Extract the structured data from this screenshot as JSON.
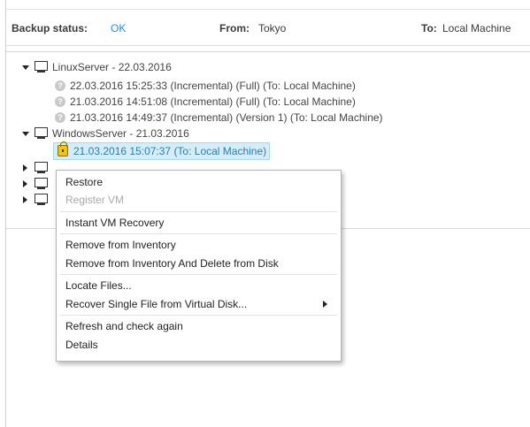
{
  "status": {
    "backup_label": "Backup status:",
    "backup_value": "OK",
    "from_label": "From:",
    "from_value": "Tokyo",
    "to_label": "To:",
    "to_value": "Local Machine"
  },
  "tree": {
    "servers": [
      {
        "label": "LinuxServer - 22.03.2016",
        "expanded": true,
        "backups": [
          "22.03.2016 15:25:33 (Incremental) (Full) (To: Local Machine)",
          "21.03.2016 14:51:08 (Incremental) (Full) (To: Local Machine)",
          "21.03.2016 14:49:37 (Incremental) (Version 1) (To: Local Machine)"
        ]
      },
      {
        "label": "WindowsServer - 21.03.2016",
        "expanded": true,
        "backups": [
          "21.03.2016 15:07:37 (To: Local Machine)"
        ]
      }
    ]
  },
  "context_menu": {
    "items": [
      {
        "label": "Restore",
        "enabled": true
      },
      {
        "label": "Register VM",
        "enabled": false
      },
      {
        "label": "Instant VM Recovery",
        "enabled": true
      },
      {
        "label": "Remove from Inventory",
        "enabled": true
      },
      {
        "label": "Remove from Inventory And Delete from Disk",
        "enabled": true
      },
      {
        "label": "Locate Files...",
        "enabled": true
      },
      {
        "label": "Recover Single File from Virtual Disk...",
        "enabled": true,
        "submenu": true
      },
      {
        "label": "Refresh and check again",
        "enabled": true
      },
      {
        "label": "Details",
        "enabled": true
      }
    ]
  },
  "colors": {
    "ok": "#1e8fd6",
    "selection_bg": "#d3eef8",
    "selection_text": "#2c7cb0",
    "lock": "#f1c40f"
  }
}
